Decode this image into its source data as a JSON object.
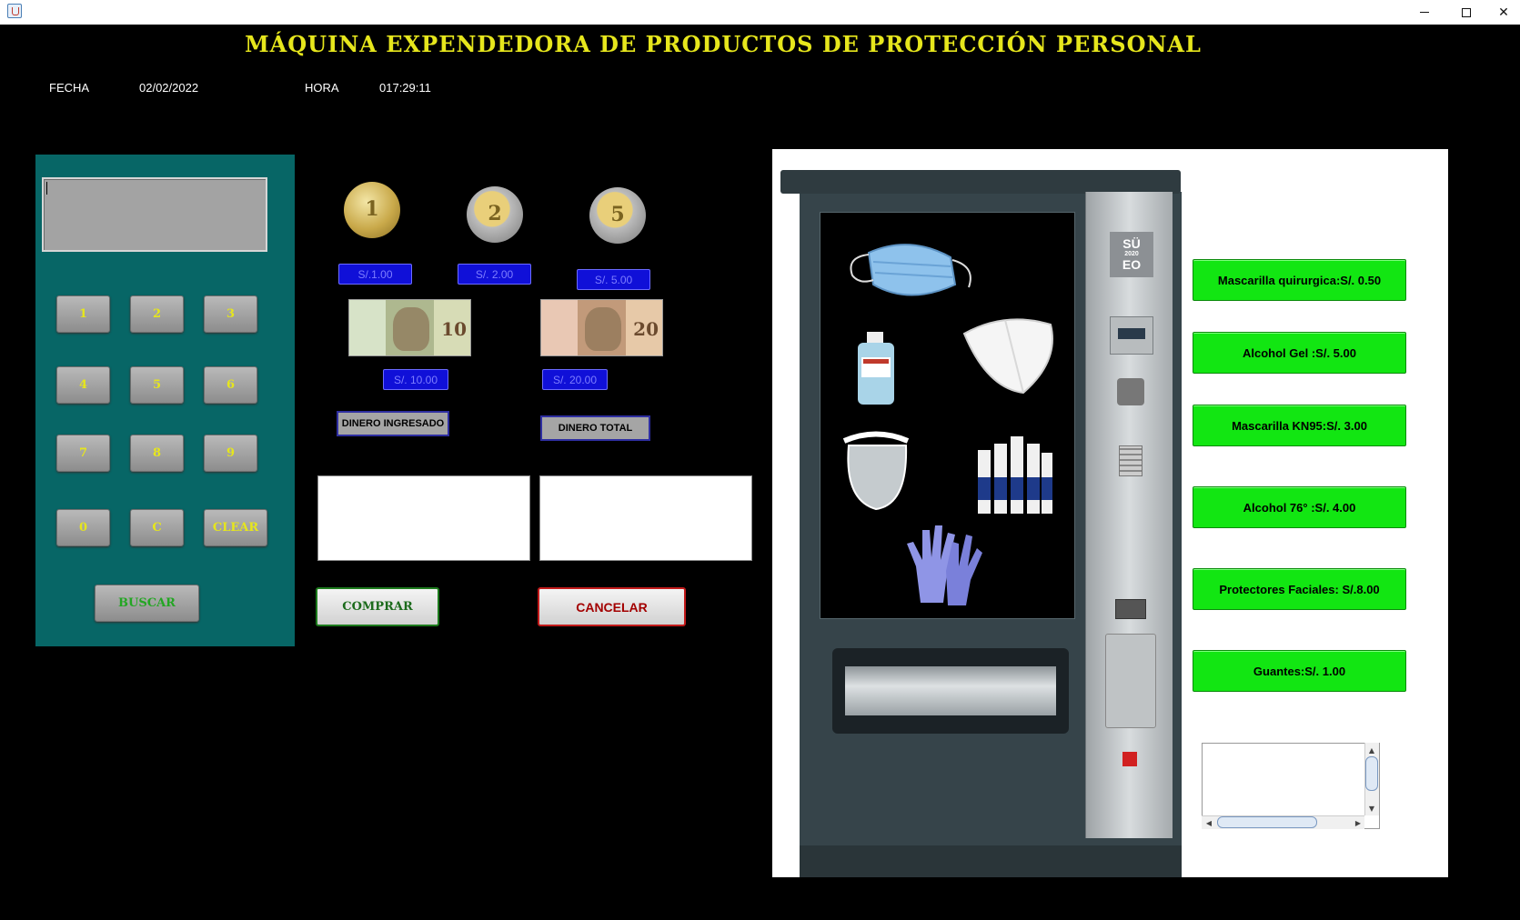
{
  "window": {
    "minimize_icon": "minimize-icon",
    "maximize_icon": "maximize-icon",
    "close_glyph": "✕"
  },
  "header": {
    "title": "MÁQUINA EXPENDEDORA DE PRODUCTOS DE PROTECCIÓN PERSONAL",
    "date_label": "FECHA",
    "date_value": "02/02/2022",
    "time_label": "HORA",
    "time_value": "017:29:11"
  },
  "keypad": {
    "display_value": "",
    "keys": [
      "1",
      "2",
      "3",
      "4",
      "5",
      "6",
      "7",
      "8",
      "9",
      "0",
      "C",
      "CLEAR"
    ],
    "search_label": "BUSCAR"
  },
  "money": {
    "coins": [
      {
        "denomination": "1",
        "label": "S/.1.00"
      },
      {
        "denomination": "2",
        "label": "S/. 2.00"
      },
      {
        "denomination": "5",
        "label": "S/. 5.00"
      }
    ],
    "bills": [
      {
        "denomination": "10",
        "label": "S/. 10.00"
      },
      {
        "denomination": "20",
        "label": "S/. 20.00"
      }
    ],
    "inserted_label": "DINERO INGRESADO",
    "total_label": "DINERO TOTAL",
    "inserted_value": "",
    "total_value": ""
  },
  "actions": {
    "buy_label": "COMPRAR",
    "cancel_label": "CANCELAR"
  },
  "machine": {
    "logo_line1": "SÜ",
    "logo_line2": "2020",
    "logo_line3": "EO",
    "products_shown": [
      "surgical-mask",
      "alcohol-gel",
      "kn95-mask",
      "face-shield",
      "alcohol-spray-bottles",
      "gloves"
    ]
  },
  "products": [
    {
      "label": "Mascarilla quirurgica:S/. 0.50"
    },
    {
      "label": "Alcohol Gel :S/. 5.00"
    },
    {
      "label": "Mascarilla KN95:S/. 3.00"
    },
    {
      "label": "Alcohol 76° :S/. 4.00"
    },
    {
      "label": "Protectores Faciales: S/.8.00"
    },
    {
      "label": "Guantes:S/. 1.00"
    }
  ],
  "output_area": {
    "text": ""
  },
  "colors": {
    "title": "#e6e61c",
    "keypad_panel": "#076666",
    "product_button": "#12e612",
    "price_button": "#1010d8",
    "buy_border": "#1c7a1c",
    "cancel_border": "#c21a1a"
  }
}
